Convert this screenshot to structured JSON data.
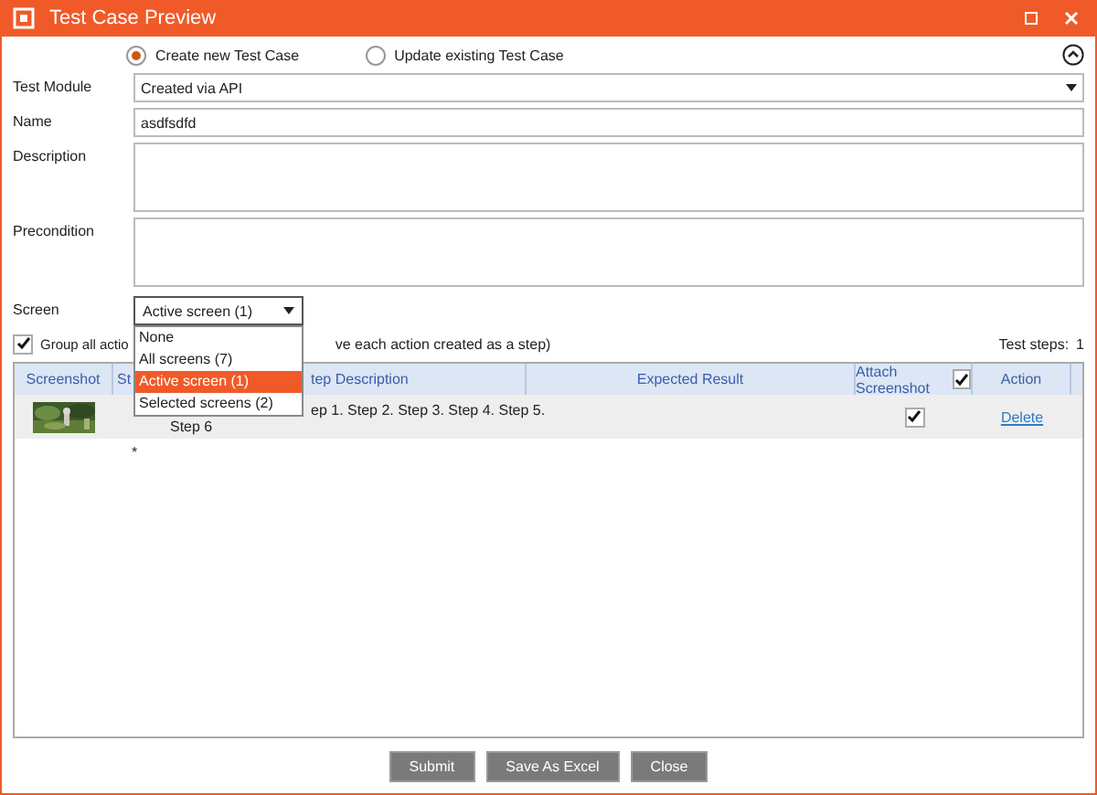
{
  "window": {
    "title": "Test Case Preview"
  },
  "mode_options": [
    {
      "label": "Create new Test Case",
      "selected": true
    },
    {
      "label": "Update existing Test Case",
      "selected": false
    }
  ],
  "form": {
    "test_module": {
      "label": "Test Module",
      "value": "Created via API"
    },
    "name": {
      "label": "Name",
      "value": "asdfsdfd"
    },
    "description": {
      "label": "Description"
    },
    "precondition": {
      "label": "Precondition"
    },
    "screen": {
      "label": "Screen",
      "value": "Active screen (1)",
      "expanded": true,
      "options": [
        {
          "label": "None",
          "selected": false
        },
        {
          "label": "All screens (7)",
          "selected": false
        },
        {
          "label": "Active screen (1)",
          "selected": true
        },
        {
          "label": "Selected screens (2)",
          "selected": false
        }
      ]
    }
  },
  "group_actions": {
    "checked": true,
    "label_start": "Group all actio",
    "label_end": "ve each action created as a step)"
  },
  "test_steps": {
    "label": "Test steps:",
    "count": "1"
  },
  "table": {
    "columns": [
      "Screenshot",
      "St",
      "tep Description",
      "Expected Result",
      "Attach Screenshot",
      "Action"
    ],
    "attach_all_checked": true,
    "rows": [
      {
        "kind": "picture",
        "description_line1": "ep 1. Step 2. Step 3. Step 4. Step 5.",
        "description_line2": "Step 6",
        "attach": true,
        "action": "Delete"
      }
    ],
    "new_row_marker": "*"
  },
  "buttons": [
    "Submit",
    "Save As Excel",
    "Close"
  ]
}
